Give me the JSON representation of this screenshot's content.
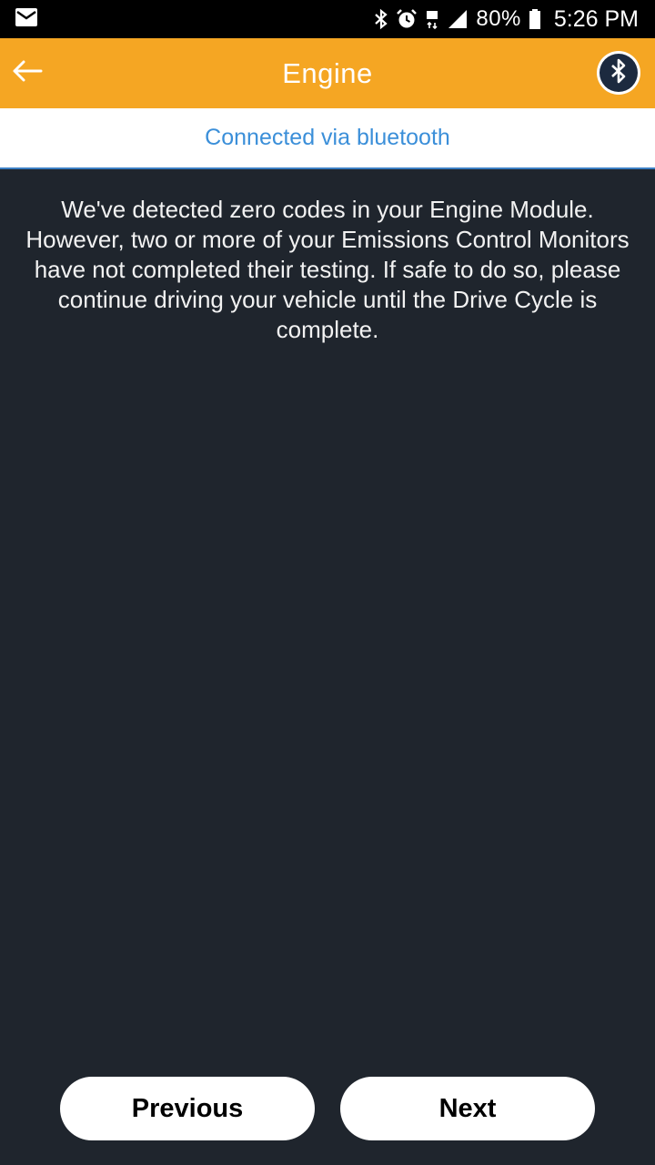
{
  "status_bar": {
    "icons": [
      "mail-icon",
      "bluetooth-icon",
      "alarm-icon",
      "data-4g-icon",
      "signal-icon",
      "battery-icon"
    ],
    "battery_percent": "80%",
    "time": "5:26 PM"
  },
  "app_bar": {
    "title": "Engine",
    "background": "#f5a623"
  },
  "connection": {
    "text": "Connected via bluetooth",
    "color": "#3b8fd9"
  },
  "message": "We've detected zero codes in your Engine Module. However, two or more of your Emissions Control Monitors have not completed their testing. If safe to do so, please continue driving your vehicle until the Drive Cycle is complete.",
  "buttons": {
    "previous": "Previous",
    "next": "Next"
  }
}
